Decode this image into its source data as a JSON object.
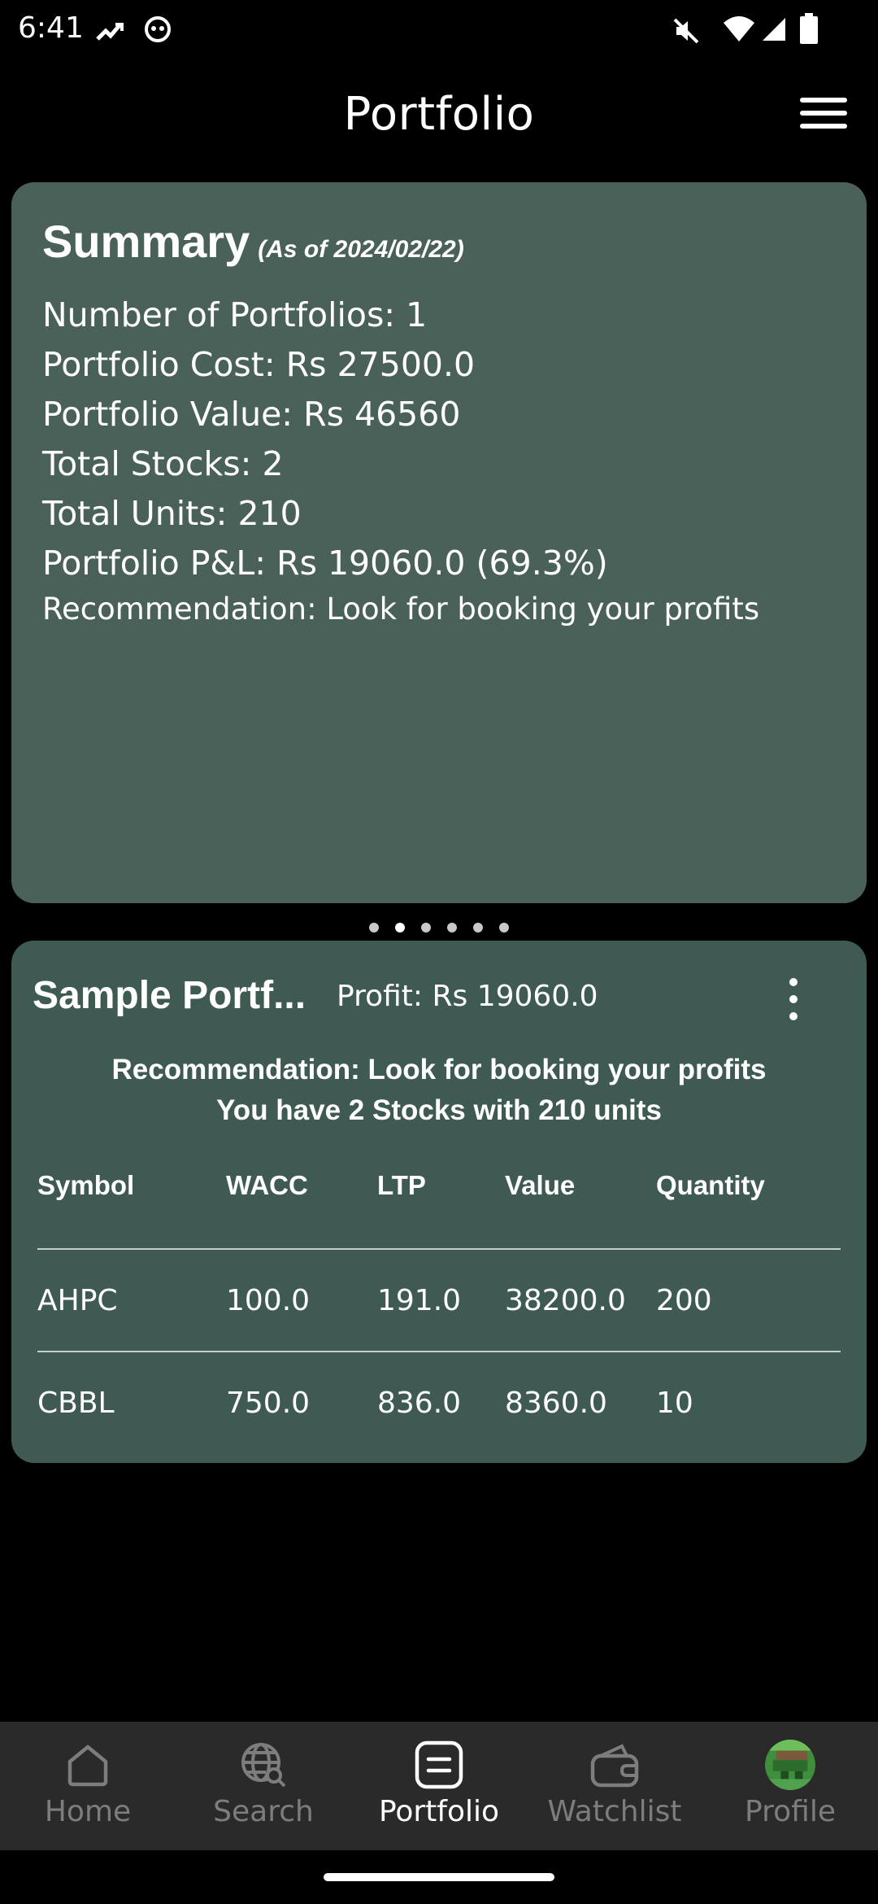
{
  "status": {
    "time": "6:41"
  },
  "header": {
    "title": "Portfolio"
  },
  "summary": {
    "title": "Summary",
    "as_of": "(As of 2024/02/22)",
    "lines": [
      "Number of Portfolios:  1",
      "Portfolio Cost: Rs 27500.0",
      "Portfolio Value: Rs  46560",
      "Total Stocks: 2",
      "Total Units:  210",
      "Portfolio P&L: Rs 19060.0 (69.3%)",
      "Recommendation:  Look for booking your profits"
    ]
  },
  "pager": {
    "count": 6,
    "active": 1
  },
  "portfolio": {
    "name": "Sample Portf...",
    "profit": "Profit: Rs 19060.0",
    "recommendation": "Recommendation:  Look for booking your profits",
    "stocks_summary": "You have 2 Stocks with 210 units",
    "columns": [
      "Symbol",
      "WACC",
      "LTP",
      "Value",
      "Quantity"
    ],
    "rows": [
      [
        "AHPC",
        "100.0",
        "191.0",
        "38200.0",
        "200"
      ],
      [
        "CBBL",
        "750.0",
        "836.0",
        "8360.0",
        "10"
      ]
    ]
  },
  "nav": {
    "items": [
      {
        "label": "Home",
        "icon": "home-icon"
      },
      {
        "label": "Search",
        "icon": "globe-search-icon"
      },
      {
        "label": "Portfolio",
        "icon": "portfolio-icon"
      },
      {
        "label": "Watchlist",
        "icon": "wallet-icon"
      },
      {
        "label": "Profile",
        "icon": "avatar-icon"
      }
    ],
    "active_index": 2
  },
  "colors": {
    "summary_card": "#4a6159",
    "portfolio_card": "#3f5a53",
    "nav_bg": "#2a2a2a"
  }
}
